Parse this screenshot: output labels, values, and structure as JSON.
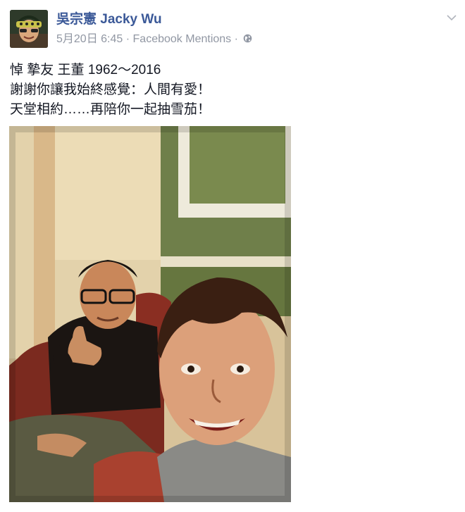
{
  "post": {
    "author": "吳宗憲 Jacky Wu",
    "date": "5月20日 6:45",
    "separator1": "·",
    "source": "Facebook Mentions",
    "separator2": "·",
    "privacy_icon": "globe-icon",
    "menu_icon": "chevron-down-icon",
    "text_lines": [
      "悼 摯友 王董 1962～2016",
      "謝謝你讓我始終感覺：人間有愛！",
      "天堂相約……再陪你一起抽雪茄！"
    ]
  },
  "colors": {
    "author_link": "#3b5998",
    "meta_text": "#9197a3",
    "body_text": "#141823"
  }
}
